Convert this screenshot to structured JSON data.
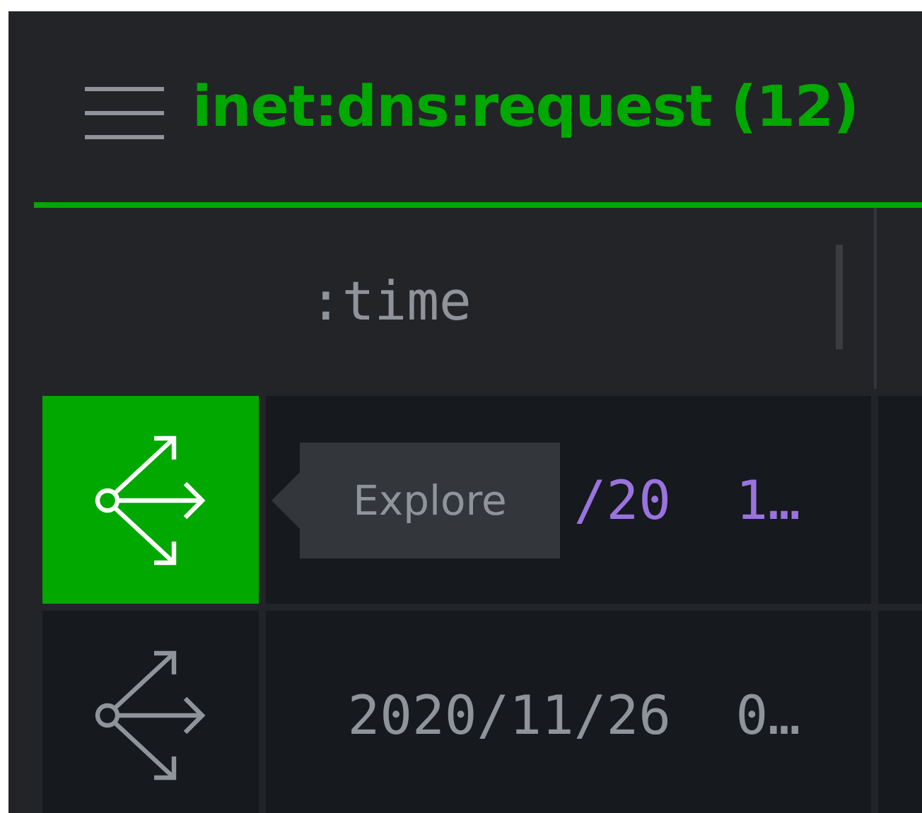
{
  "title": "inet:dns:request (12)",
  "columns": [
    {
      "label": ":time"
    }
  ],
  "rows": [
    {
      "selected": true,
      "time": "/20  1…"
    },
    {
      "selected": false,
      "time": "2020/11/26  0…"
    }
  ],
  "tooltip": {
    "text": "Explore"
  }
}
